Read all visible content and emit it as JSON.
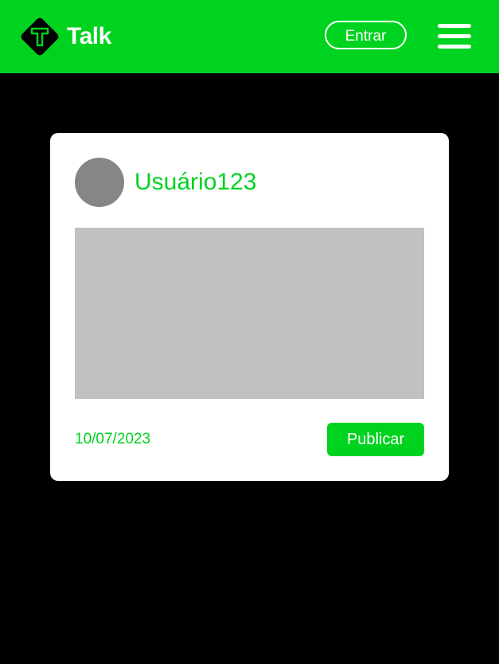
{
  "header": {
    "logo_letter": "T",
    "brand_name": "Talk",
    "login_label": "Entrar",
    "menu_icon": "hamburger-menu-icon"
  },
  "post": {
    "username": "Usuário123",
    "date": "10/07/2023",
    "publish_label": "Publicar"
  },
  "colors": {
    "brand_green": "#00d31f",
    "background": "#000000",
    "card": "#ffffff",
    "avatar": "#868686",
    "image_placeholder": "#c1c1c1"
  }
}
